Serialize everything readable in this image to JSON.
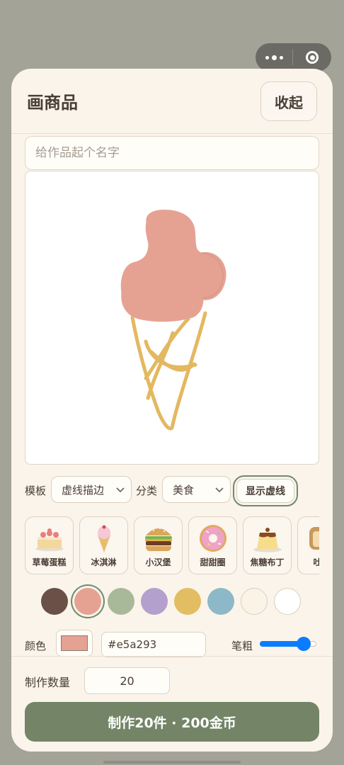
{
  "capsule": {
    "more_icon": "more-dots-icon",
    "close_icon": "target-circle-icon"
  },
  "header": {
    "title": "画商品",
    "collapse_label": "收起"
  },
  "name_input": {
    "placeholder": "给作品起个名字",
    "value": ""
  },
  "canvas": {
    "drawing": "ice-cream-sketch",
    "scoop_color": "#e5a293",
    "cone_color": "#e3b860"
  },
  "options": {
    "template_label": "模板",
    "template_value": "虚线描边",
    "category_label": "分类",
    "category_value": "美食",
    "toggle_dash_label": "显示虚线"
  },
  "templates": [
    {
      "label": "草莓蛋糕",
      "icon": "strawberry-cake-icon"
    },
    {
      "label": "冰淇淋",
      "icon": "ice-cream-icon"
    },
    {
      "label": "小汉堡",
      "icon": "burger-icon"
    },
    {
      "label": "甜甜圈",
      "icon": "donut-icon"
    },
    {
      "label": "焦糖布丁",
      "icon": "pudding-icon"
    },
    {
      "label": "吐司",
      "icon": "toast-icon"
    }
  ],
  "palette": [
    "#6b5047",
    "#e5a293",
    "#a8b99a",
    "#b3a0cc",
    "#e3bd62",
    "#8db8c7",
    "#fbf4e6",
    "#ffffff"
  ],
  "palette_selected": 1,
  "color": {
    "label": "颜色",
    "hex": "#e5a293"
  },
  "brush": {
    "label": "笔粗",
    "value_fraction": 0.78,
    "accent": "#0a7cff"
  },
  "quantity": {
    "label": "制作数量",
    "value": "20"
  },
  "make_button": {
    "label": "制作20件 · 200金币",
    "color": "#738566"
  }
}
